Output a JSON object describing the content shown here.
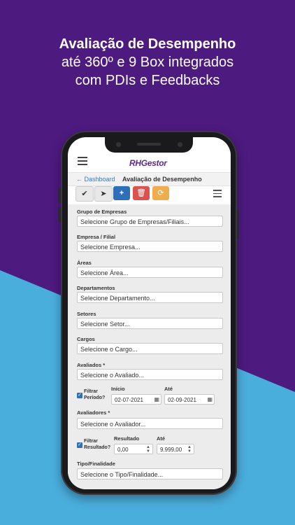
{
  "headline": {
    "line1": "Avaliação de Desempenho",
    "line2": "até 360º e 9 Box integrados",
    "line3": "com PDIs e Feedbacks"
  },
  "app": {
    "logo": "RHGestor"
  },
  "breadcrumb": {
    "back": "← Dashboard",
    "current": "Avaliação de Desempenho"
  },
  "toolbar": {
    "add": "+",
    "delete": "🗑",
    "sync": "⟳",
    "check": "✔",
    "send": "➤"
  },
  "form": {
    "grupo": {
      "label": "Grupo de Empresas",
      "value": "Selecione Grupo de Empresas/Filiais..."
    },
    "empresa": {
      "label": "Empresa / Filial",
      "value": "Selecione Empresa..."
    },
    "areas": {
      "label": "Áreas",
      "value": "Selecione Área..."
    },
    "departamentos": {
      "label": "Departamentos",
      "value": "Selecione Departamento..."
    },
    "setores": {
      "label": "Setores",
      "value": "Selecione Setor..."
    },
    "cargos": {
      "label": "Cargos",
      "value": "Selecione o Cargo..."
    },
    "avaliados": {
      "label": "Avaliados *",
      "value": "Selecione o Avaliado..."
    },
    "periodo": {
      "check_label_1": "Filtrar",
      "check_label_2": "Período?",
      "inicio_label": "Início",
      "inicio_value": "02-07-2021",
      "ate_label": "Até",
      "ate_value": "02-09-2021"
    },
    "avaliadores": {
      "label": "Avaliadores *",
      "value": "Selecione o Avaliador..."
    },
    "resultado": {
      "check_label_1": "Filtrar",
      "check_label_2": "Resultado?",
      "min_label": "Resultado",
      "min_value": "0,00",
      "max_label": "Até",
      "max_value": "9.999,00"
    },
    "tipo": {
      "label": "Tipo/Finalidade",
      "value": "Selecione o Tipo/Finalidade..."
    }
  },
  "colors": {
    "purple_bg": "#4d1a7f",
    "blue_bg": "#4aaedd",
    "primary": "#2e6fb8",
    "danger": "#d9534f",
    "warning": "#f0ad4e"
  }
}
